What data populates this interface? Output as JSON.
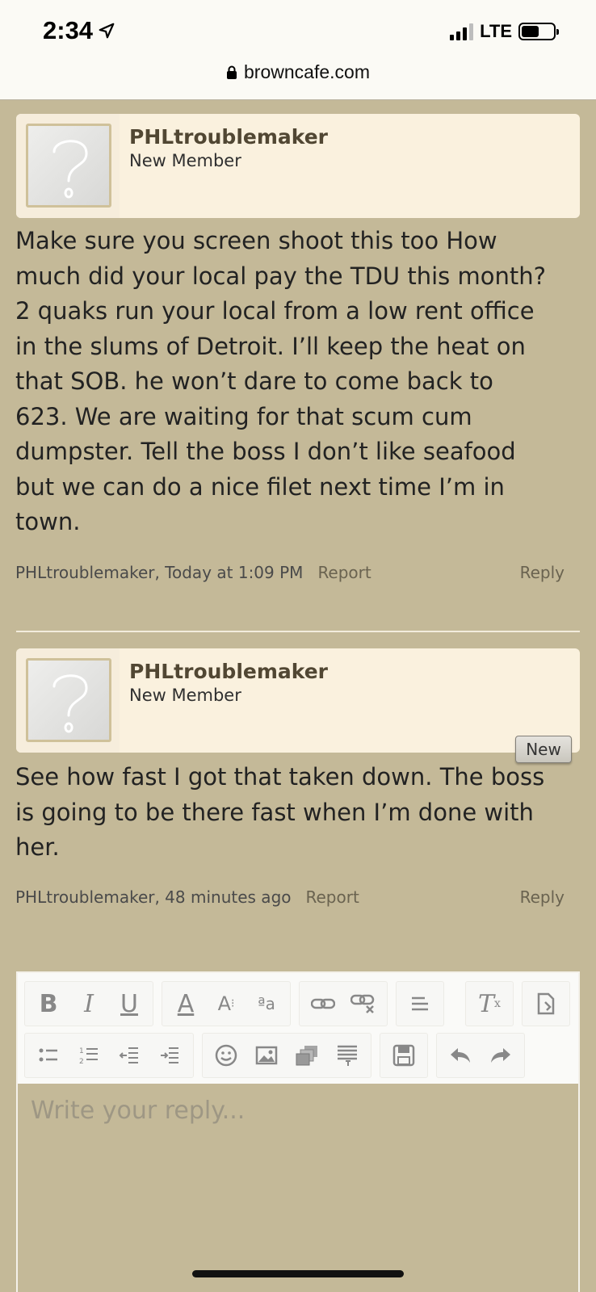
{
  "status_bar": {
    "time": "2:34",
    "network": "LTE"
  },
  "url_bar": {
    "domain": "browncafe.com"
  },
  "posts": [
    {
      "username": "PHLtroublemaker",
      "title": "New Member",
      "body": "Make sure you screen shoot this too How much did your local pay the TDU this month? 2 quaks run your local from a low rent office in the slums of Detroit. I’ll keep the heat on that SOB. he won’t dare to come back to 623. We are waiting for that scum cum dumpster. Tell the boss I don’t like seafood but we can do a nice filet next time I’m in town.",
      "meta": "PHLtroublemaker, Today at 1:09 PM",
      "report_label": "Report",
      "reply_label": "Reply"
    },
    {
      "username": "PHLtroublemaker",
      "title": "New Member",
      "badge": "New",
      "body": "See how fast I got that taken down. The boss is going to be there fast when I’m done with her.",
      "meta": "PHLtroublemaker, 48 minutes ago",
      "report_label": "Report",
      "reply_label": "Reply"
    }
  ],
  "editor": {
    "placeholder": "Write your reply...",
    "toolbar_row1": [
      [
        "bold-icon",
        "italic-icon",
        "underline-icon"
      ],
      [
        "text-color-icon",
        "font-size-icon",
        "font-family-icon"
      ],
      [
        "link-icon",
        "unlink-icon"
      ],
      [
        "align-icon"
      ],
      [
        "remove-format-icon"
      ],
      [
        "toggle-bbcode-icon"
      ]
    ],
    "toolbar_row2": [
      [
        "bulleted-list-icon",
        "numbered-list-icon",
        "outdent-icon",
        "indent-icon"
      ],
      [
        "smilie-icon",
        "image-icon",
        "media-icon",
        "quote-icon"
      ],
      [
        "save-draft-icon"
      ],
      [
        "undo-icon",
        "redo-icon"
      ]
    ]
  },
  "colors": {
    "background": "#c4b998",
    "header_bg": "#faf1de",
    "username": "#514733"
  }
}
